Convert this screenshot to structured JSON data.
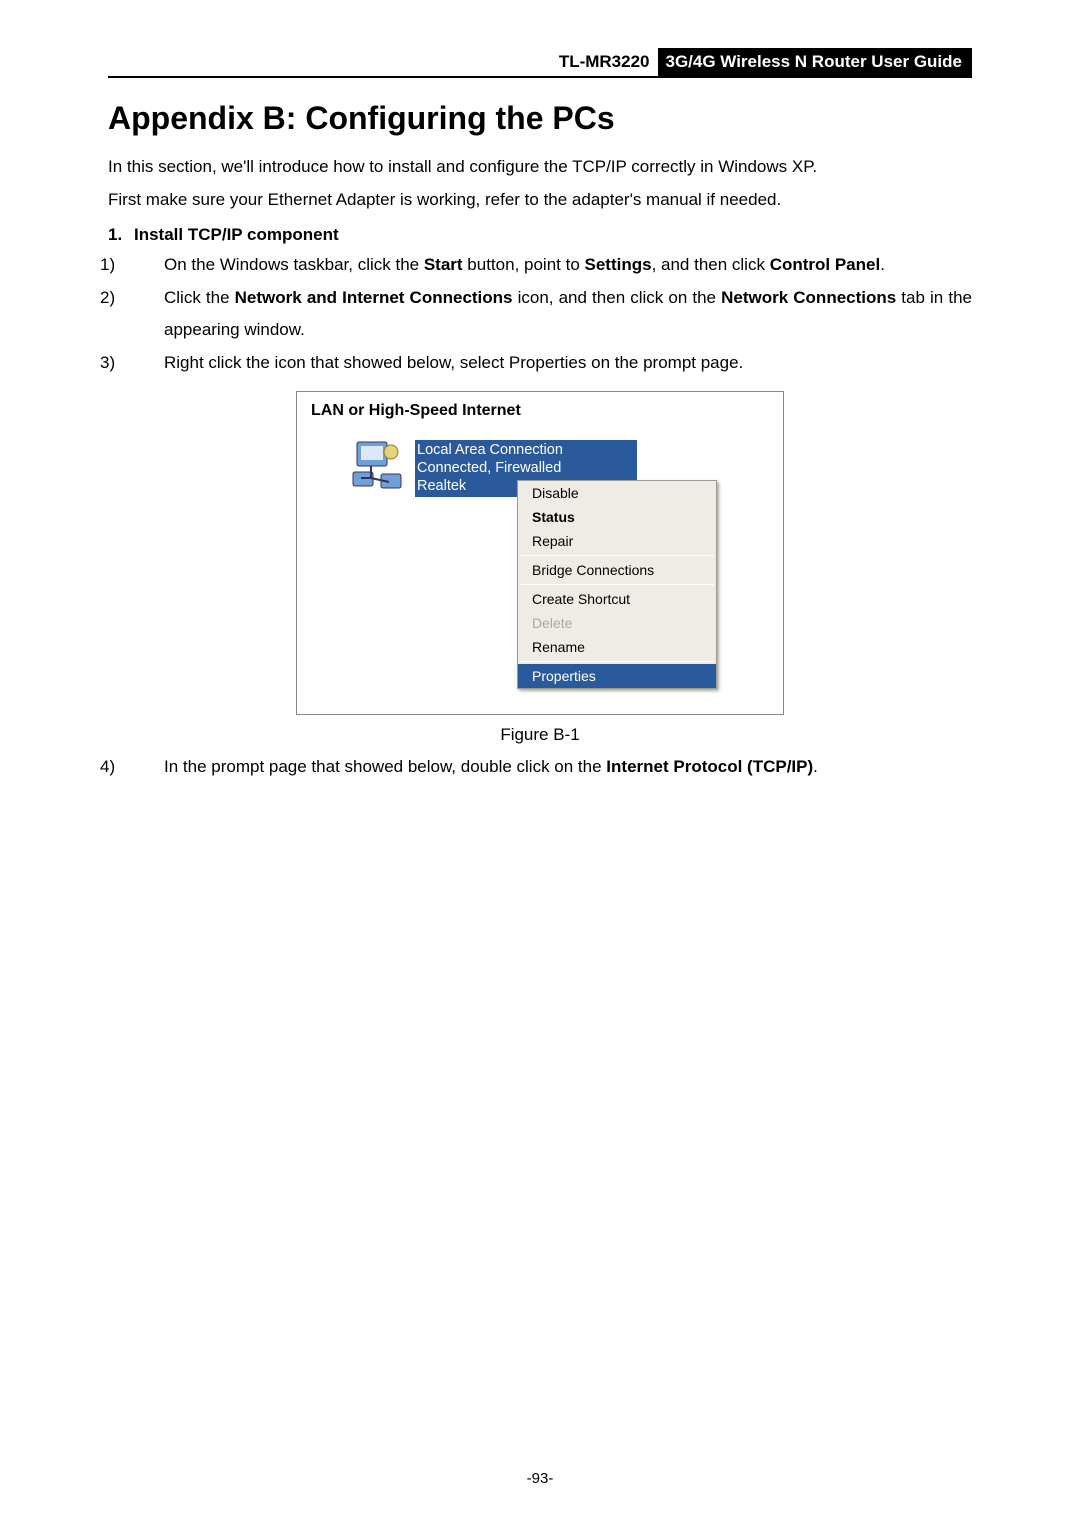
{
  "header": {
    "model": "TL-MR3220",
    "guide": "3G/4G Wireless N Router User Guide"
  },
  "title": "Appendix B: Configuring the PCs",
  "intro1": "In this section, we'll introduce how to install and configure the TCP/IP correctly in Windows XP.",
  "intro2": "First make sure your Ethernet Adapter is working, refer to the adapter's manual if needed.",
  "section": {
    "num": "1.",
    "head": "Install TCP/IP component"
  },
  "steps": {
    "s1": {
      "n": "1)",
      "pre": "On the Windows taskbar, click the ",
      "b1": "Start",
      "mid1": " button, point to ",
      "b2": "Settings",
      "mid2": ", and then click ",
      "b3": "Control Panel",
      "post": "."
    },
    "s2": {
      "n": "2)",
      "pre": "Click the ",
      "b1": "Network and Internet Connections",
      "mid1": " icon, and then click on the ",
      "b2": "Network Connections",
      "post": " tab in the appearing window."
    },
    "s3": {
      "n": "3)",
      "text": "Right click the icon that showed below, select Properties on the prompt page."
    },
    "s4": {
      "n": "4)",
      "pre": "In the prompt page that showed below, double click on the ",
      "b1": "Internet Protocol (TCP/IP)",
      "post": "."
    }
  },
  "figure": {
    "group_title": "LAN or High-Speed Internet",
    "conn_name": "Local Area Connection",
    "conn_state": "Connected, Firewalled",
    "adapter": "Realtek",
    "menu": {
      "disable": "Disable",
      "status": "Status",
      "repair": "Repair",
      "bridge": "Bridge Connections",
      "shortcut": "Create Shortcut",
      "delete": "Delete",
      "rename": "Rename",
      "properties": "Properties"
    },
    "caption": "Figure B-1"
  },
  "page_number": "-93-"
}
